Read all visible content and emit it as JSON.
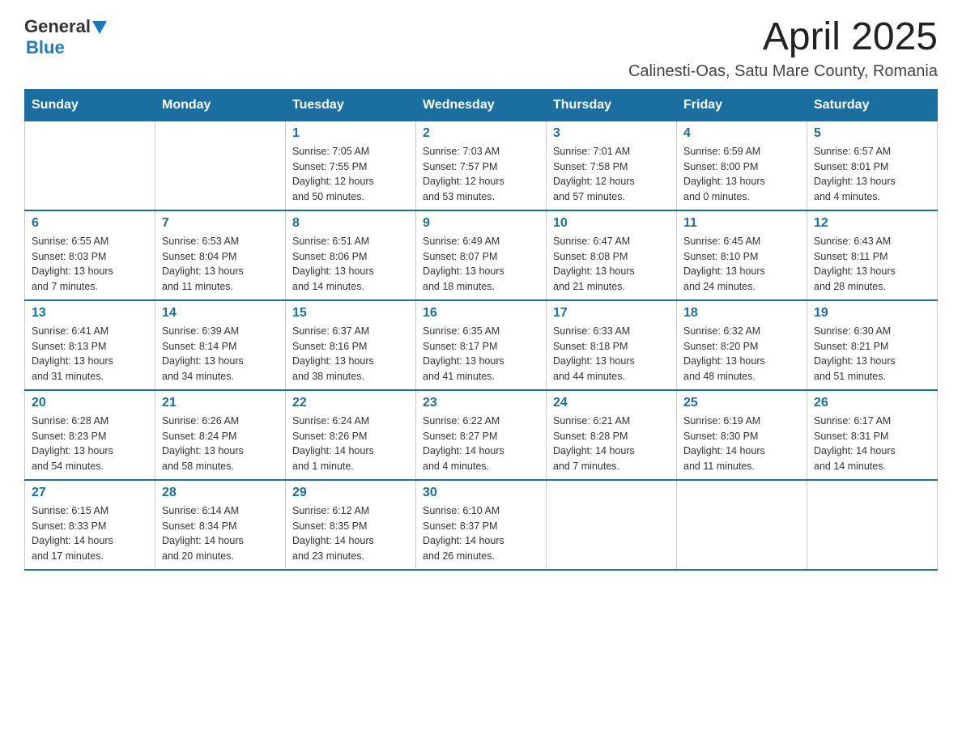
{
  "logo": {
    "text_general": "General",
    "text_blue": "Blue"
  },
  "header": {
    "title": "April 2025",
    "subtitle": "Calinesti-Oas, Satu Mare County, Romania"
  },
  "columns": [
    "Sunday",
    "Monday",
    "Tuesday",
    "Wednesday",
    "Thursday",
    "Friday",
    "Saturday"
  ],
  "weeks": [
    [
      {
        "day": "",
        "info": ""
      },
      {
        "day": "",
        "info": ""
      },
      {
        "day": "1",
        "info": "Sunrise: 7:05 AM\nSunset: 7:55 PM\nDaylight: 12 hours\nand 50 minutes."
      },
      {
        "day": "2",
        "info": "Sunrise: 7:03 AM\nSunset: 7:57 PM\nDaylight: 12 hours\nand 53 minutes."
      },
      {
        "day": "3",
        "info": "Sunrise: 7:01 AM\nSunset: 7:58 PM\nDaylight: 12 hours\nand 57 minutes."
      },
      {
        "day": "4",
        "info": "Sunrise: 6:59 AM\nSunset: 8:00 PM\nDaylight: 13 hours\nand 0 minutes."
      },
      {
        "day": "5",
        "info": "Sunrise: 6:57 AM\nSunset: 8:01 PM\nDaylight: 13 hours\nand 4 minutes."
      }
    ],
    [
      {
        "day": "6",
        "info": "Sunrise: 6:55 AM\nSunset: 8:03 PM\nDaylight: 13 hours\nand 7 minutes."
      },
      {
        "day": "7",
        "info": "Sunrise: 6:53 AM\nSunset: 8:04 PM\nDaylight: 13 hours\nand 11 minutes."
      },
      {
        "day": "8",
        "info": "Sunrise: 6:51 AM\nSunset: 8:06 PM\nDaylight: 13 hours\nand 14 minutes."
      },
      {
        "day": "9",
        "info": "Sunrise: 6:49 AM\nSunset: 8:07 PM\nDaylight: 13 hours\nand 18 minutes."
      },
      {
        "day": "10",
        "info": "Sunrise: 6:47 AM\nSunset: 8:08 PM\nDaylight: 13 hours\nand 21 minutes."
      },
      {
        "day": "11",
        "info": "Sunrise: 6:45 AM\nSunset: 8:10 PM\nDaylight: 13 hours\nand 24 minutes."
      },
      {
        "day": "12",
        "info": "Sunrise: 6:43 AM\nSunset: 8:11 PM\nDaylight: 13 hours\nand 28 minutes."
      }
    ],
    [
      {
        "day": "13",
        "info": "Sunrise: 6:41 AM\nSunset: 8:13 PM\nDaylight: 13 hours\nand 31 minutes."
      },
      {
        "day": "14",
        "info": "Sunrise: 6:39 AM\nSunset: 8:14 PM\nDaylight: 13 hours\nand 34 minutes."
      },
      {
        "day": "15",
        "info": "Sunrise: 6:37 AM\nSunset: 8:16 PM\nDaylight: 13 hours\nand 38 minutes."
      },
      {
        "day": "16",
        "info": "Sunrise: 6:35 AM\nSunset: 8:17 PM\nDaylight: 13 hours\nand 41 minutes."
      },
      {
        "day": "17",
        "info": "Sunrise: 6:33 AM\nSunset: 8:18 PM\nDaylight: 13 hours\nand 44 minutes."
      },
      {
        "day": "18",
        "info": "Sunrise: 6:32 AM\nSunset: 8:20 PM\nDaylight: 13 hours\nand 48 minutes."
      },
      {
        "day": "19",
        "info": "Sunrise: 6:30 AM\nSunset: 8:21 PM\nDaylight: 13 hours\nand 51 minutes."
      }
    ],
    [
      {
        "day": "20",
        "info": "Sunrise: 6:28 AM\nSunset: 8:23 PM\nDaylight: 13 hours\nand 54 minutes."
      },
      {
        "day": "21",
        "info": "Sunrise: 6:26 AM\nSunset: 8:24 PM\nDaylight: 13 hours\nand 58 minutes."
      },
      {
        "day": "22",
        "info": "Sunrise: 6:24 AM\nSunset: 8:26 PM\nDaylight: 14 hours\nand 1 minute."
      },
      {
        "day": "23",
        "info": "Sunrise: 6:22 AM\nSunset: 8:27 PM\nDaylight: 14 hours\nand 4 minutes."
      },
      {
        "day": "24",
        "info": "Sunrise: 6:21 AM\nSunset: 8:28 PM\nDaylight: 14 hours\nand 7 minutes."
      },
      {
        "day": "25",
        "info": "Sunrise: 6:19 AM\nSunset: 8:30 PM\nDaylight: 14 hours\nand 11 minutes."
      },
      {
        "day": "26",
        "info": "Sunrise: 6:17 AM\nSunset: 8:31 PM\nDaylight: 14 hours\nand 14 minutes."
      }
    ],
    [
      {
        "day": "27",
        "info": "Sunrise: 6:15 AM\nSunset: 8:33 PM\nDaylight: 14 hours\nand 17 minutes."
      },
      {
        "day": "28",
        "info": "Sunrise: 6:14 AM\nSunset: 8:34 PM\nDaylight: 14 hours\nand 20 minutes."
      },
      {
        "day": "29",
        "info": "Sunrise: 6:12 AM\nSunset: 8:35 PM\nDaylight: 14 hours\nand 23 minutes."
      },
      {
        "day": "30",
        "info": "Sunrise: 6:10 AM\nSunset: 8:37 PM\nDaylight: 14 hours\nand 26 minutes."
      },
      {
        "day": "",
        "info": ""
      },
      {
        "day": "",
        "info": ""
      },
      {
        "day": "",
        "info": ""
      }
    ]
  ]
}
